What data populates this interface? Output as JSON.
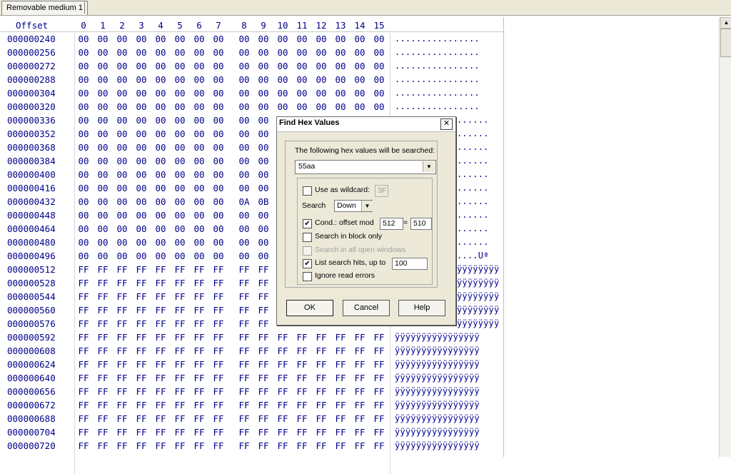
{
  "tab": {
    "label": "Removable medium 1"
  },
  "hex": {
    "offset_header": "Offset",
    "columns": [
      "0",
      "1",
      "2",
      "3",
      "4",
      "5",
      "6",
      "7",
      "8",
      "9",
      "10",
      "11",
      "12",
      "13",
      "14",
      "15"
    ],
    "rows": [
      {
        "offset": "000000240",
        "bytes": [
          "00",
          "00",
          "00",
          "00",
          "00",
          "00",
          "00",
          "00",
          "00",
          "00",
          "00",
          "00",
          "00",
          "00",
          "00",
          "00"
        ],
        "ascii": "................"
      },
      {
        "offset": "000000256",
        "bytes": [
          "00",
          "00",
          "00",
          "00",
          "00",
          "00",
          "00",
          "00",
          "00",
          "00",
          "00",
          "00",
          "00",
          "00",
          "00",
          "00"
        ],
        "ascii": "................"
      },
      {
        "offset": "000000272",
        "bytes": [
          "00",
          "00",
          "00",
          "00",
          "00",
          "00",
          "00",
          "00",
          "00",
          "00",
          "00",
          "00",
          "00",
          "00",
          "00",
          "00"
        ],
        "ascii": "................"
      },
      {
        "offset": "000000288",
        "bytes": [
          "00",
          "00",
          "00",
          "00",
          "00",
          "00",
          "00",
          "00",
          "00",
          "00",
          "00",
          "00",
          "00",
          "00",
          "00",
          "00"
        ],
        "ascii": "................"
      },
      {
        "offset": "000000304",
        "bytes": [
          "00",
          "00",
          "00",
          "00",
          "00",
          "00",
          "00",
          "00",
          "00",
          "00",
          "00",
          "00",
          "00",
          "00",
          "00",
          "00"
        ],
        "ascii": "................"
      },
      {
        "offset": "000000320",
        "bytes": [
          "00",
          "00",
          "00",
          "00",
          "00",
          "00",
          "00",
          "00",
          "00",
          "00",
          "00",
          "00",
          "00",
          "00",
          "00",
          "00"
        ],
        "ascii": "................"
      },
      {
        "offset": "000000336",
        "bytes": [
          "00",
          "00",
          "00",
          "00",
          "00",
          "00",
          "00",
          "00",
          "00",
          "00",
          "",
          "",
          "",
          "",
          "",
          ""
        ],
        "ascii": "......"
      },
      {
        "offset": "000000352",
        "bytes": [
          "00",
          "00",
          "00",
          "00",
          "00",
          "00",
          "00",
          "00",
          "00",
          "00",
          "",
          "",
          "",
          "",
          "",
          ""
        ],
        "ascii": "......"
      },
      {
        "offset": "000000368",
        "bytes": [
          "00",
          "00",
          "00",
          "00",
          "00",
          "00",
          "00",
          "00",
          "00",
          "00",
          "",
          "",
          "",
          "",
          "",
          ""
        ],
        "ascii": "......"
      },
      {
        "offset": "000000384",
        "bytes": [
          "00",
          "00",
          "00",
          "00",
          "00",
          "00",
          "00",
          "00",
          "00",
          "00",
          "",
          "",
          "",
          "",
          "",
          ""
        ],
        "ascii": "......"
      },
      {
        "offset": "000000400",
        "bytes": [
          "00",
          "00",
          "00",
          "00",
          "00",
          "00",
          "00",
          "00",
          "00",
          "00",
          "",
          "",
          "",
          "",
          "",
          ""
        ],
        "ascii": "......"
      },
      {
        "offset": "000000416",
        "bytes": [
          "00",
          "00",
          "00",
          "00",
          "00",
          "00",
          "00",
          "00",
          "00",
          "00",
          "",
          "",
          "",
          "",
          "",
          ""
        ],
        "ascii": "......"
      },
      {
        "offset": "000000432",
        "bytes": [
          "00",
          "00",
          "00",
          "00",
          "00",
          "00",
          "00",
          "00",
          "0A",
          "0B",
          "",
          "",
          "",
          "",
          "",
          ""
        ],
        "ascii": "......"
      },
      {
        "offset": "000000448",
        "bytes": [
          "00",
          "00",
          "00",
          "00",
          "00",
          "00",
          "00",
          "00",
          "00",
          "00",
          "",
          "",
          "",
          "",
          "",
          ""
        ],
        "ascii": "......"
      },
      {
        "offset": "000000464",
        "bytes": [
          "00",
          "00",
          "00",
          "00",
          "00",
          "00",
          "00",
          "00",
          "00",
          "00",
          "",
          "",
          "",
          "",
          "",
          ""
        ],
        "ascii": "......"
      },
      {
        "offset": "000000480",
        "bytes": [
          "00",
          "00",
          "00",
          "00",
          "00",
          "00",
          "00",
          "00",
          "00",
          "00",
          "",
          "",
          "",
          "",
          "",
          ""
        ],
        "ascii": "......"
      },
      {
        "offset": "000000496",
        "bytes": [
          "00",
          "00",
          "00",
          "00",
          "00",
          "00",
          "00",
          "00",
          "00",
          "00",
          "",
          "",
          "",
          "",
          "",
          ""
        ],
        "ascii": "....Uª"
      },
      {
        "offset": "000000512",
        "bytes": [
          "FF",
          "FF",
          "FF",
          "FF",
          "FF",
          "FF",
          "FF",
          "FF",
          "FF",
          "FF",
          "",
          "",
          "",
          "",
          "",
          ""
        ],
        "ascii": "ÿÿÿÿÿÿÿÿ"
      },
      {
        "offset": "000000528",
        "bytes": [
          "FF",
          "FF",
          "FF",
          "FF",
          "FF",
          "FF",
          "FF",
          "FF",
          "FF",
          "FF",
          "",
          "",
          "",
          "",
          "",
          ""
        ],
        "ascii": "ÿÿÿÿÿÿÿÿ"
      },
      {
        "offset": "000000544",
        "bytes": [
          "FF",
          "FF",
          "FF",
          "FF",
          "FF",
          "FF",
          "FF",
          "FF",
          "FF",
          "FF",
          "",
          "",
          "",
          "",
          "",
          ""
        ],
        "ascii": "ÿÿÿÿÿÿÿÿ"
      },
      {
        "offset": "000000560",
        "bytes": [
          "FF",
          "FF",
          "FF",
          "FF",
          "FF",
          "FF",
          "FF",
          "FF",
          "FF",
          "FF",
          "",
          "",
          "",
          "",
          "",
          ""
        ],
        "ascii": "ÿÿÿÿÿÿÿÿ"
      },
      {
        "offset": "000000576",
        "bytes": [
          "FF",
          "FF",
          "FF",
          "FF",
          "FF",
          "FF",
          "FF",
          "FF",
          "FF",
          "FF",
          "",
          "",
          "",
          "",
          "",
          ""
        ],
        "ascii": "ÿÿÿÿÿÿÿÿ"
      },
      {
        "offset": "000000592",
        "bytes": [
          "FF",
          "FF",
          "FF",
          "FF",
          "FF",
          "FF",
          "FF",
          "FF",
          "FF",
          "FF",
          "FF",
          "FF",
          "FF",
          "FF",
          "FF",
          "FF"
        ],
        "ascii": "ÿÿÿÿÿÿÿÿÿÿÿÿÿÿÿÿ"
      },
      {
        "offset": "000000608",
        "bytes": [
          "FF",
          "FF",
          "FF",
          "FF",
          "FF",
          "FF",
          "FF",
          "FF",
          "FF",
          "FF",
          "FF",
          "FF",
          "FF",
          "FF",
          "FF",
          "FF"
        ],
        "ascii": "ÿÿÿÿÿÿÿÿÿÿÿÿÿÿÿÿ"
      },
      {
        "offset": "000000624",
        "bytes": [
          "FF",
          "FF",
          "FF",
          "FF",
          "FF",
          "FF",
          "FF",
          "FF",
          "FF",
          "FF",
          "FF",
          "FF",
          "FF",
          "FF",
          "FF",
          "FF"
        ],
        "ascii": "ÿÿÿÿÿÿÿÿÿÿÿÿÿÿÿÿ"
      },
      {
        "offset": "000000640",
        "bytes": [
          "FF",
          "FF",
          "FF",
          "FF",
          "FF",
          "FF",
          "FF",
          "FF",
          "FF",
          "FF",
          "FF",
          "FF",
          "FF",
          "FF",
          "FF",
          "FF"
        ],
        "ascii": "ÿÿÿÿÿÿÿÿÿÿÿÿÿÿÿÿ"
      },
      {
        "offset": "000000656",
        "bytes": [
          "FF",
          "FF",
          "FF",
          "FF",
          "FF",
          "FF",
          "FF",
          "FF",
          "FF",
          "FF",
          "FF",
          "FF",
          "FF",
          "FF",
          "FF",
          "FF"
        ],
        "ascii": "ÿÿÿÿÿÿÿÿÿÿÿÿÿÿÿÿ"
      },
      {
        "offset": "000000672",
        "bytes": [
          "FF",
          "FF",
          "FF",
          "FF",
          "FF",
          "FF",
          "FF",
          "FF",
          "FF",
          "FF",
          "FF",
          "FF",
          "FF",
          "FF",
          "FF",
          "FF"
        ],
        "ascii": "ÿÿÿÿÿÿÿÿÿÿÿÿÿÿÿÿ"
      },
      {
        "offset": "000000688",
        "bytes": [
          "FF",
          "FF",
          "FF",
          "FF",
          "FF",
          "FF",
          "FF",
          "FF",
          "FF",
          "FF",
          "FF",
          "FF",
          "FF",
          "FF",
          "FF",
          "FF"
        ],
        "ascii": "ÿÿÿÿÿÿÿÿÿÿÿÿÿÿÿÿ"
      },
      {
        "offset": "000000704",
        "bytes": [
          "FF",
          "FF",
          "FF",
          "FF",
          "FF",
          "FF",
          "FF",
          "FF",
          "FF",
          "FF",
          "FF",
          "FF",
          "FF",
          "FF",
          "FF",
          "FF"
        ],
        "ascii": "ÿÿÿÿÿÿÿÿÿÿÿÿÿÿÿÿ"
      },
      {
        "offset": "000000720",
        "bytes": [
          "FF",
          "FF",
          "FF",
          "FF",
          "FF",
          "FF",
          "FF",
          "FF",
          "FF",
          "FF",
          "FF",
          "FF",
          "FF",
          "FF",
          "FF",
          "FF"
        ],
        "ascii": "ÿÿÿÿÿÿÿÿÿÿÿÿÿÿÿÿ"
      }
    ]
  },
  "dialog": {
    "title": "Find Hex Values",
    "close_glyph": "✕",
    "prompt": "The following hex values will be searched:",
    "search_value": "55aa",
    "wildcard": {
      "label": "Use as wildcard:",
      "checked": false,
      "value": "3F"
    },
    "search_dir": {
      "label": "Search",
      "value": "Down"
    },
    "cond": {
      "label": "Cond.: offset mod",
      "checked": true,
      "mod": "512",
      "equals": "=",
      "result": "510"
    },
    "block_only": {
      "label": "Search in block only",
      "checked": false
    },
    "all_windows": {
      "label": "Search in all open windows",
      "checked": false
    },
    "list_hits": {
      "label": "List search hits, up to",
      "checked": true,
      "value": "100"
    },
    "ignore_errors": {
      "label": "Ignore read errors",
      "checked": false
    },
    "buttons": {
      "ok": "OK",
      "cancel": "Cancel",
      "help": "Help"
    }
  },
  "icons": {
    "close": "close-icon",
    "dropdown": "chevron-down-icon",
    "scroll_up": "arrow-up-icon"
  },
  "colors": {
    "hex_text": "#00008b",
    "dialog_bg": "#ece9d8"
  }
}
